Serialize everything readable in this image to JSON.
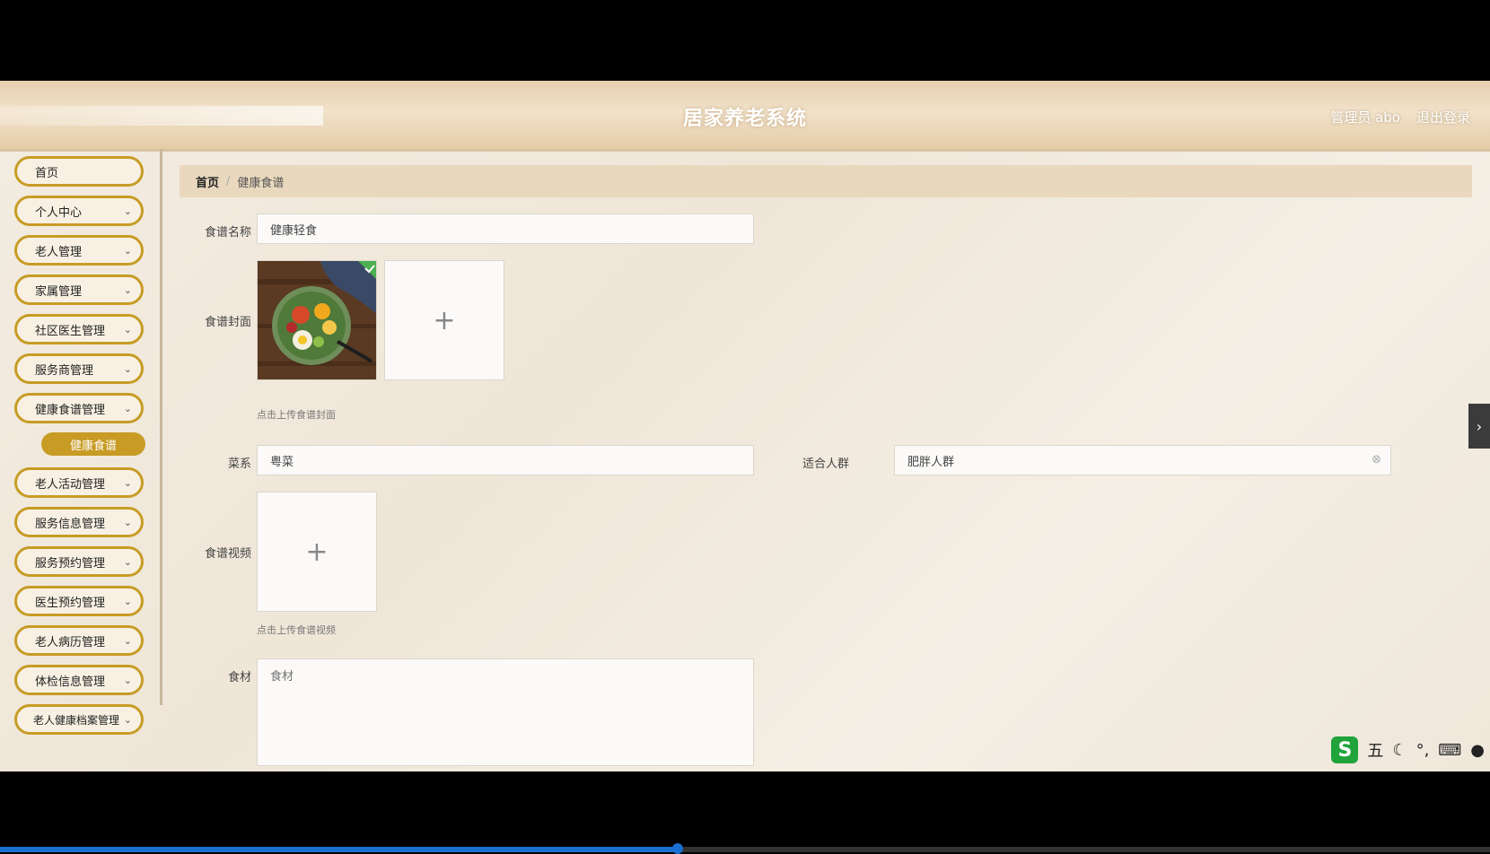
{
  "header": {
    "title": "居家养老系统",
    "user": "管理员 abo",
    "logout": "退出登录"
  },
  "sidebar": {
    "items": [
      {
        "label": "首页",
        "has_chevron": false
      },
      {
        "label": "个人中心",
        "has_chevron": true
      },
      {
        "label": "老人管理",
        "has_chevron": true
      },
      {
        "label": "家属管理",
        "has_chevron": true
      },
      {
        "label": "社区医生管理",
        "has_chevron": true
      },
      {
        "label": "服务商管理",
        "has_chevron": true
      },
      {
        "label": "健康食谱管理",
        "has_chevron": true
      },
      {
        "label": "老人活动管理",
        "has_chevron": true
      },
      {
        "label": "服务信息管理",
        "has_chevron": true
      },
      {
        "label": "服务预约管理",
        "has_chevron": true
      },
      {
        "label": "医生预约管理",
        "has_chevron": true
      },
      {
        "label": "老人病历管理",
        "has_chevron": true
      },
      {
        "label": "体检信息管理",
        "has_chevron": true
      },
      {
        "label": "老人健康档案管理",
        "has_chevron": true
      }
    ],
    "active_sub": "健康食谱"
  },
  "breadcrumb": {
    "home": "首页",
    "current": "健康食谱"
  },
  "form": {
    "name_label": "食谱名称",
    "name_value": "健康轻食",
    "cover_label": "食谱封面",
    "cover_hint": "点击上传食谱封面",
    "cuisine_label": "菜系",
    "cuisine_value": "粤菜",
    "crowd_label": "适合人群",
    "crowd_value": "肥胖人群",
    "video_label": "食谱视频",
    "video_hint": "点击上传食谱视频",
    "ingredients_label": "食材",
    "ingredients_placeholder": "食材",
    "plus": "+"
  },
  "ime": {
    "logo": "S",
    "mode": "五"
  },
  "colors": {
    "accent": "#c79c25",
    "breadcrumb_bg": "#e9d8bd",
    "progress": "#1b6fd2"
  },
  "video_progress": 0.455
}
